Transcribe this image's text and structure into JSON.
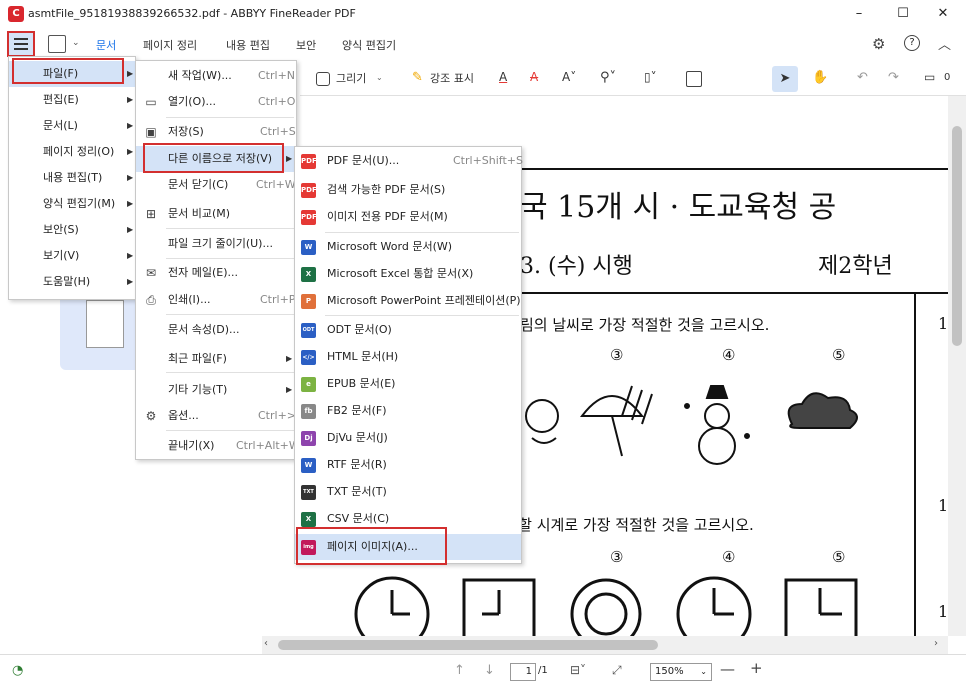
{
  "window": {
    "title": "asmtFile_95181938839266532.pdf - ABBYY FineReader PDF",
    "app_icon": "ABBYY FineReader icon",
    "controls": {
      "minimize": "–",
      "maximize": "☐",
      "close": "✕"
    }
  },
  "ribbon": {
    "tabs": [
      "문서",
      "페이지 정리",
      "내용 편집",
      "보안",
      "양식 편집기"
    ],
    "active_tab": "문서"
  },
  "tools": {
    "draw_label": "그리기",
    "highlight_label": "강조 표시",
    "comments_count": "0"
  },
  "main_menu": {
    "items": [
      "파일(F)",
      "편집(E)",
      "문서(L)",
      "페이지 정리(O)",
      "내용 편집(T)",
      "양식 편집기(M)",
      "보안(S)",
      "보기(V)",
      "도움말(H)"
    ]
  },
  "file_menu": {
    "items": [
      {
        "label": "새 작업(W)...",
        "shortcut": "Ctrl+N"
      },
      {
        "label": "열기(O)...",
        "shortcut": "Ctrl+O"
      },
      {
        "label": "저장(S)",
        "shortcut": "Ctrl+S"
      },
      {
        "label": "다른 이름으로 저장(V)",
        "shortcut": ""
      },
      {
        "label": "문서 닫기(C)",
        "shortcut": "Ctrl+W"
      },
      {
        "label": "문서 비교(M)",
        "shortcut": ""
      },
      {
        "label": "파일 크기 줄이기(U)...",
        "shortcut": ""
      },
      {
        "label": "전자 메일(E)...",
        "shortcut": ""
      },
      {
        "label": "인쇄(I)...",
        "shortcut": "Ctrl+P"
      },
      {
        "label": "문서 속성(D)...",
        "shortcut": ""
      },
      {
        "label": "최근 파일(F)",
        "shortcut": ""
      },
      {
        "label": "기타 기능(T)",
        "shortcut": ""
      },
      {
        "label": "옵션...",
        "shortcut": "Ctrl+>"
      },
      {
        "label": "끝내기(X)",
        "shortcut": "Ctrl+Alt+W"
      }
    ]
  },
  "save_as_menu": {
    "items": [
      {
        "label": "PDF 문서(U)...",
        "shortcut": "Ctrl+Shift+S",
        "icon": "PDF",
        "color": "#e53935"
      },
      {
        "label": "검색 가능한 PDF 문서(S)",
        "shortcut": "",
        "icon": "PDF",
        "color": "#e53935"
      },
      {
        "label": "이미지 전용 PDF 문서(M)",
        "shortcut": "",
        "icon": "PDF",
        "color": "#e53935"
      },
      {
        "label": "Microsoft Word 문서(W)",
        "shortcut": "",
        "icon": "W",
        "color": "#2b5fc4"
      },
      {
        "label": "Microsoft Excel 통합 문서(X)",
        "shortcut": "",
        "icon": "X",
        "color": "#1e7145"
      },
      {
        "label": "Microsoft PowerPoint 프레젠테이션(P)",
        "shortcut": "",
        "icon": "P",
        "color": "#e0703a"
      },
      {
        "label": "ODT 문서(O)",
        "shortcut": "",
        "icon": "ODT",
        "color": "#2b5fc4"
      },
      {
        "label": "HTML 문서(H)",
        "shortcut": "",
        "icon": "</>",
        "color": "#2b5fc4"
      },
      {
        "label": "EPUB 문서(E)",
        "shortcut": "",
        "icon": "e",
        "color": "#7cb342"
      },
      {
        "label": "FB2 문서(F)",
        "shortcut": "",
        "icon": "fb",
        "color": "#888888"
      },
      {
        "label": "DjVu 문서(J)",
        "shortcut": "",
        "icon": "Dj",
        "color": "#8e44ad"
      },
      {
        "label": "RTF 문서(R)",
        "shortcut": "",
        "icon": "W",
        "color": "#2b5fc4"
      },
      {
        "label": "TXT 문서(T)",
        "shortcut": "",
        "icon": "TXT",
        "color": "#333333"
      },
      {
        "label": "CSV 문서(C)",
        "shortcut": "",
        "icon": "X",
        "color": "#1e7145"
      },
      {
        "label": "페이지 이미지(A)...",
        "shortcut": "",
        "icon": "img",
        "color": "#c2185b"
      }
    ]
  },
  "document": {
    "heading": "국 15개 시 · 도교육청 공",
    "subheading_left": "3. (수) 시행",
    "subheading_right": "제2학년",
    "q1": "림의 날씨로 가장 적절한 것을 고르시오.",
    "q2": "이 구입할 시계로 가장 적절한 것을 고르시오.",
    "choices": [
      "③",
      "④",
      "⑤"
    ],
    "margin_numbers": [
      "1",
      "1",
      "1"
    ]
  },
  "status": {
    "page_current": "1",
    "page_total": "/1",
    "zoom": "150%"
  }
}
